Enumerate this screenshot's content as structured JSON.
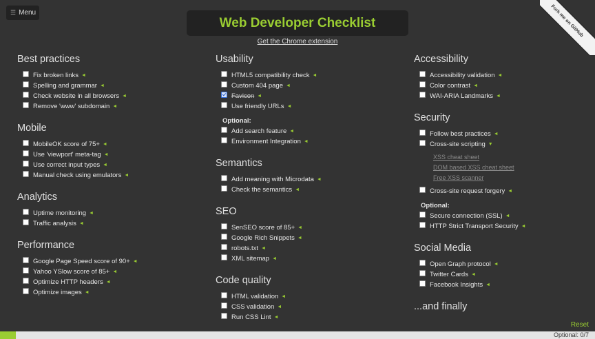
{
  "menu": {
    "label": "Menu",
    "icon": "menu-icon"
  },
  "ribbon": {
    "text": "Fork me on GitHub"
  },
  "title": "Web Developer Checklist",
  "extension_link": "Get the Chrome extension",
  "columns": [
    [
      {
        "title": "Best practices",
        "items": [
          {
            "label": "Fix broken links",
            "checked": false
          },
          {
            "label": "Spelling and grammar",
            "checked": false
          },
          {
            "label": "Check website in all browsers",
            "checked": false
          },
          {
            "label": "Remove 'www' subdomain",
            "checked": false
          }
        ]
      },
      {
        "title": "Mobile",
        "items": [
          {
            "label": "MobileOK score of 75+",
            "checked": false
          },
          {
            "label": "Use 'viewport' meta-tag",
            "checked": false
          },
          {
            "label": "Use correct input types",
            "checked": false
          },
          {
            "label": "Manual check using emulators",
            "checked": false
          }
        ]
      },
      {
        "title": "Analytics",
        "items": [
          {
            "label": "Uptime monitoring",
            "checked": false
          },
          {
            "label": "Traffic analysis",
            "checked": false
          }
        ]
      },
      {
        "title": "Performance",
        "items": [
          {
            "label": "Google Page Speed score of 90+",
            "checked": false
          },
          {
            "label": "Yahoo YSlow score of 85+",
            "checked": false
          },
          {
            "label": "Optimize HTTP headers",
            "checked": false
          },
          {
            "label": "Optimize images",
            "checked": false
          }
        ]
      }
    ],
    [
      {
        "title": "Usability",
        "items": [
          {
            "label": "HTML5 compatibility check",
            "checked": false
          },
          {
            "label": "Custom 404 page",
            "checked": false
          },
          {
            "label": "Favicon",
            "checked": true
          },
          {
            "label": "Use friendly URLs",
            "checked": false
          }
        ],
        "optional_label": "Optional:",
        "optional_items": [
          {
            "label": "Add search feature",
            "checked": false
          },
          {
            "label": "Environment Integration",
            "checked": false
          }
        ]
      },
      {
        "title": "Semantics",
        "items": [
          {
            "label": "Add meaning with Microdata",
            "checked": false
          },
          {
            "label": "Check the semantics",
            "checked": false
          }
        ]
      },
      {
        "title": "SEO",
        "items": [
          {
            "label": "SenSEO score of 85+",
            "checked": false
          },
          {
            "label": "Google Rich Snippets",
            "checked": false
          },
          {
            "label": "robots.txt",
            "checked": false
          },
          {
            "label": "XML sitemap",
            "checked": false
          }
        ]
      },
      {
        "title": "Code quality",
        "items": [
          {
            "label": "HTML validation",
            "checked": false
          },
          {
            "label": "CSS validation",
            "checked": false
          },
          {
            "label": "Run CSS Lint",
            "checked": false
          }
        ]
      }
    ],
    [
      {
        "title": "Accessibility",
        "items": [
          {
            "label": "Accessibility validation",
            "checked": false
          },
          {
            "label": "Color contrast",
            "checked": false
          },
          {
            "label": "WAI-ARIA Landmarks",
            "checked": false
          }
        ]
      },
      {
        "title": "Security",
        "items": [
          {
            "label": "Follow best practices",
            "checked": false
          },
          {
            "label": "Cross-site scripting",
            "checked": false,
            "expanded": true,
            "links": [
              "XSS cheat sheet",
              "DOM based XSS cheat sheet",
              "Free XSS scanner"
            ]
          },
          {
            "label": "Cross-site request forgery",
            "checked": false
          }
        ],
        "optional_label": "Optional:",
        "optional_items": [
          {
            "label": "Secure connection (SSL)",
            "checked": false
          },
          {
            "label": "HTTP Strict Transport Security",
            "checked": false
          }
        ]
      },
      {
        "title": "Social Media",
        "items": [
          {
            "label": "Open Graph protocol",
            "checked": false
          },
          {
            "label": "Twitter Cards",
            "checked": false
          },
          {
            "label": "Facebook Insights",
            "checked": false
          }
        ]
      },
      {
        "title": "...and finally",
        "items": []
      }
    ]
  ],
  "reset_label": "Reset",
  "progress": {
    "text": "Optional: 0/7",
    "fraction": 0.027
  },
  "colors": {
    "accent": "#9acd32",
    "background": "#333333"
  }
}
